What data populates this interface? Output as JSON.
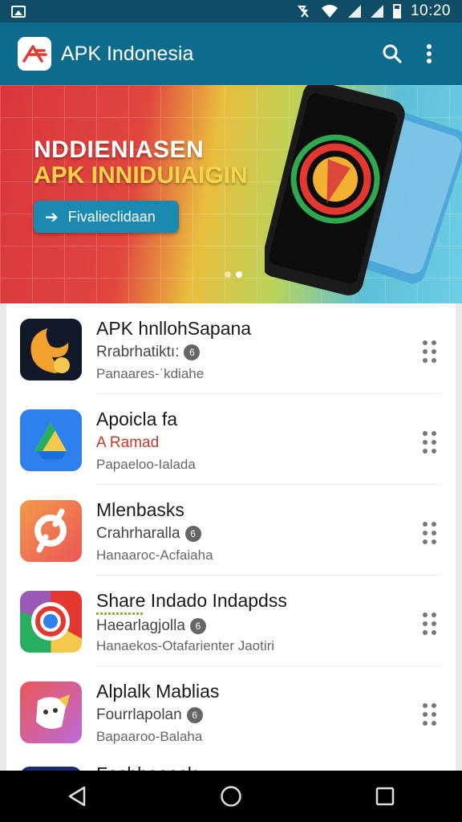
{
  "status_bar": {
    "time": "10:20"
  },
  "app_bar": {
    "title": "APK Indonesia"
  },
  "banner": {
    "headline_1": "NDDIENIASEN",
    "headline_2": "APK INNIDUIAIGIN",
    "cta_label": "Fivalieclidaan",
    "slide_count": 2,
    "active_slide": 2
  },
  "apps": [
    {
      "name": "APK hnllohSapana",
      "developer": "Rrabrhatiktı:",
      "badge": "6",
      "meta": "Panaares-ˈkdiahe",
      "accent": false
    },
    {
      "name": "Apoicla fa",
      "developer": "A Ramad",
      "badge": "",
      "meta": "Papaeloo-Ialada",
      "accent": true
    },
    {
      "name": "Mlenbasks",
      "developer": "Crahrharalla",
      "badge": "6",
      "meta": "Hanaaroc-Acfaiaha",
      "accent": false
    },
    {
      "name": "Share Indado Indapdss",
      "developer": "Haearlagjolla",
      "badge": "6",
      "meta": "Hanaekos-Otafarienter Jaotiri",
      "accent": false
    },
    {
      "name": "Alplalk Mablias",
      "developer": "Fourrlapolan",
      "badge": "6",
      "meta": "Bapaaroo-Balaha",
      "accent": false
    },
    {
      "name": "Fasbhaeosk",
      "developer": "",
      "badge": "",
      "meta": "",
      "accent": false
    }
  ],
  "colors": {
    "app_bar": "#0e6b8b",
    "status_bar": "#0f4d66",
    "accent_text": "#c0392b",
    "cta": "#1c8ab0"
  },
  "icons": {
    "status": [
      "image-icon",
      "mute-icon",
      "wifi-icon",
      "signal-icon",
      "signal-icon",
      "battery-icon"
    ],
    "app_bar": [
      "apk-logo-icon",
      "search-icon",
      "more-vert-icon"
    ],
    "nav": [
      "back-icon",
      "home-icon",
      "recents-icon"
    ]
  }
}
